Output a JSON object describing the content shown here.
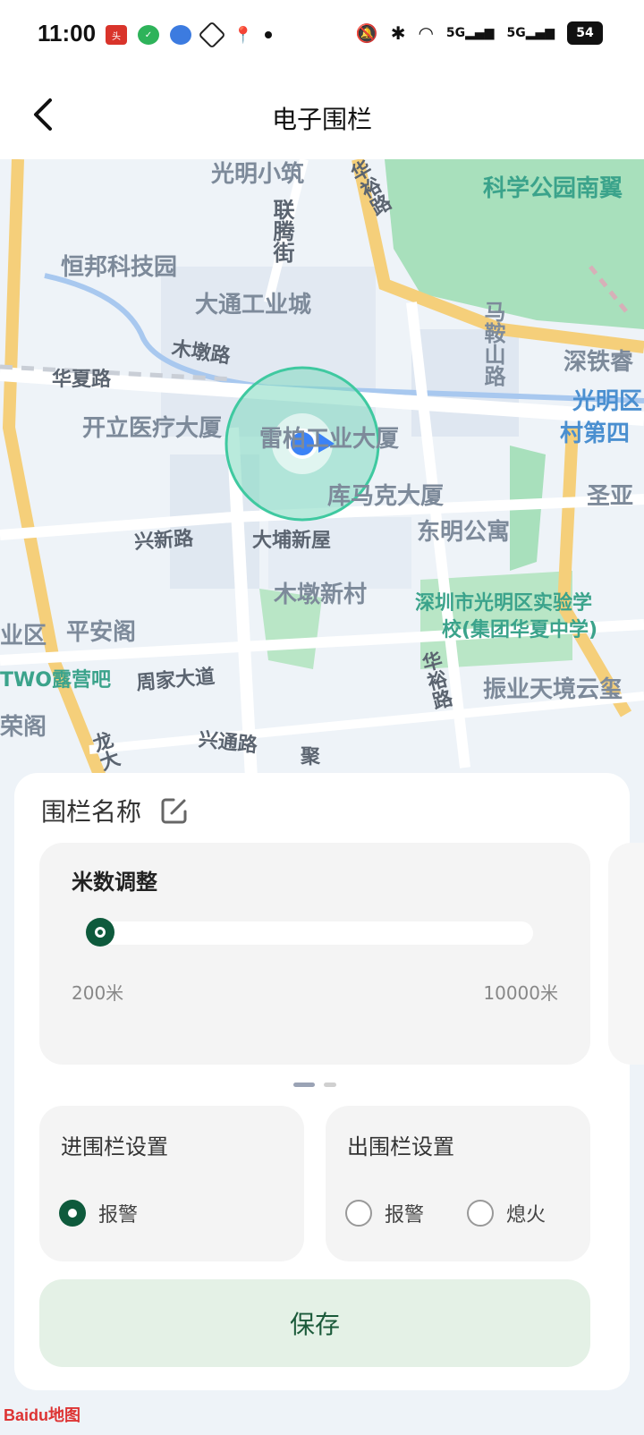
{
  "status_bar": {
    "time": "11:00",
    "left_icons": [
      "toutiao-app-icon",
      "shield-app-icon",
      "browser-app-icon",
      "diamond-app-icon",
      "location-app-icon"
    ],
    "right_icons": [
      "bell-off-icon",
      "bluetooth-icon",
      "wifi-icon",
      "signal-5g-icon",
      "signal-5g-icon",
      "battery-icon"
    ],
    "signal_label": "5G",
    "battery_level": "54"
  },
  "header": {
    "title": "电子围栏"
  },
  "map": {
    "labels": [
      "光明小筑",
      "科学公园南翼",
      "联腾街",
      "华裕路",
      "恒邦科技园",
      "大通工业城",
      "马鞍山路",
      "木墩路",
      "深铁睿",
      "华夏路",
      "光明区",
      "开立医疗大厦",
      "雷柏工业大厦",
      "村第四",
      "库马克大厦",
      "圣亚",
      "兴新路",
      "大埔新屋",
      "东明公寓",
      "木墩新村",
      "深圳市光明区实验学",
      "校(集团华夏中学)",
      "平安阁",
      "业区",
      "TWO露营吧",
      "周家大道",
      "振业天境云玺",
      "荣阁",
      "兴通路",
      "聚",
      "龙大",
      "华裕路"
    ],
    "attribution": "Baidu地图"
  },
  "panel": {
    "fence_name_label": "围栏名称",
    "range": {
      "title": "米数调整",
      "min_label": "200米",
      "max_label": "10000米",
      "value": 200
    },
    "enter": {
      "title": "进围栏设置",
      "options": [
        {
          "label": "报警",
          "checked": true
        }
      ]
    },
    "exit": {
      "title": "出围栏设置",
      "options": [
        {
          "label": "报警",
          "checked": false
        },
        {
          "label": "熄火",
          "checked": false
        }
      ]
    },
    "save_label": "保存"
  },
  "colors": {
    "accent": "#0e5a3c",
    "save_bg": "#e4f1e6",
    "fence_fill": "#7fd9c0",
    "location_dot": "#3b82f6",
    "park_green": "#8fd6a8",
    "road_yellow": "#f5cf7a"
  }
}
